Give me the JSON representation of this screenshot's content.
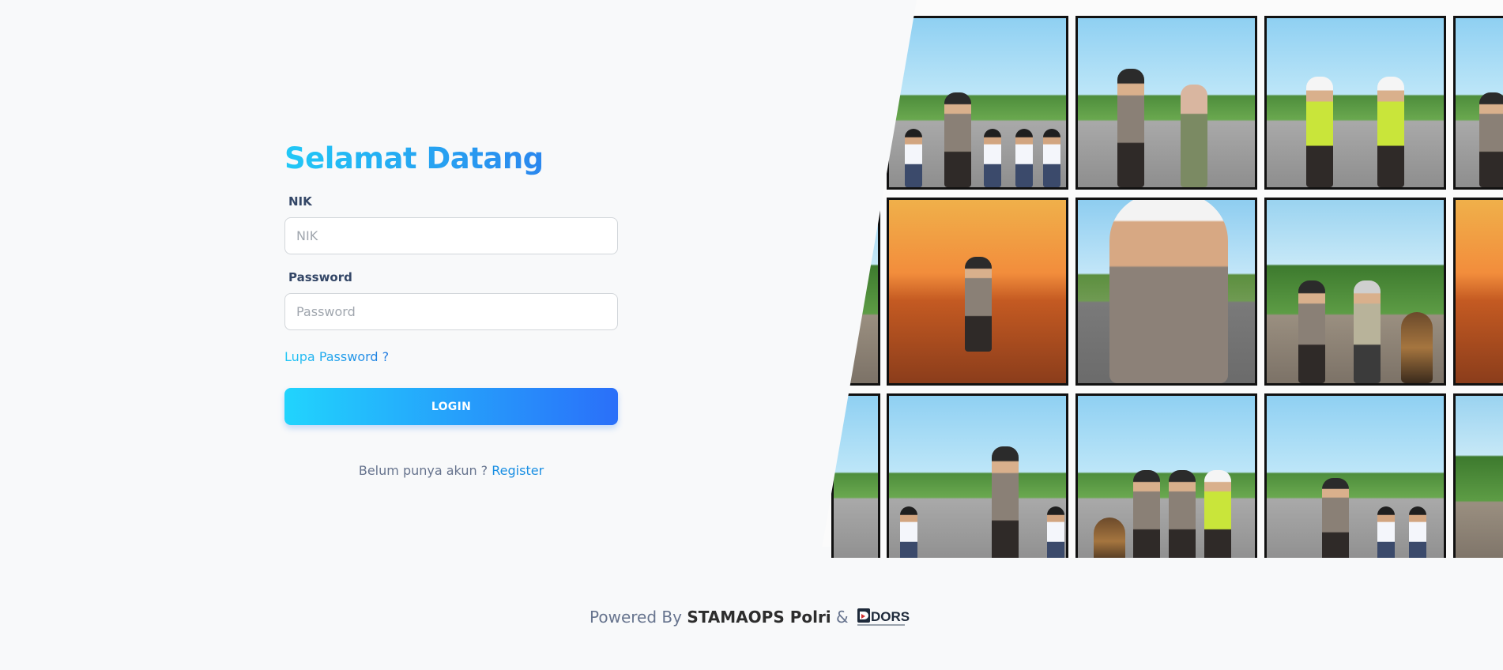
{
  "login": {
    "title": "Selamat Datang",
    "nik_label": "NIK",
    "nik_placeholder": "NIK",
    "nik_value": "",
    "password_label": "Password",
    "password_placeholder": "Password",
    "password_value": "",
    "forgot_label": "Lupa Password ?",
    "login_button": "LOGIN",
    "register_prompt": "Belum punya akun ?",
    "register_link": "Register"
  },
  "footer": {
    "powered_by": "Powered By",
    "brand": "STAMAOPS Polri",
    "ampersand": "&",
    "partner_logo": "DORS"
  },
  "colors": {
    "accent_start": "#21d4fd",
    "accent_end": "#2a6ff9",
    "link": "#1a8fe3",
    "background": "#f8f9fa"
  },
  "illustration": {
    "icon": "police-comic-collage-illustration"
  }
}
